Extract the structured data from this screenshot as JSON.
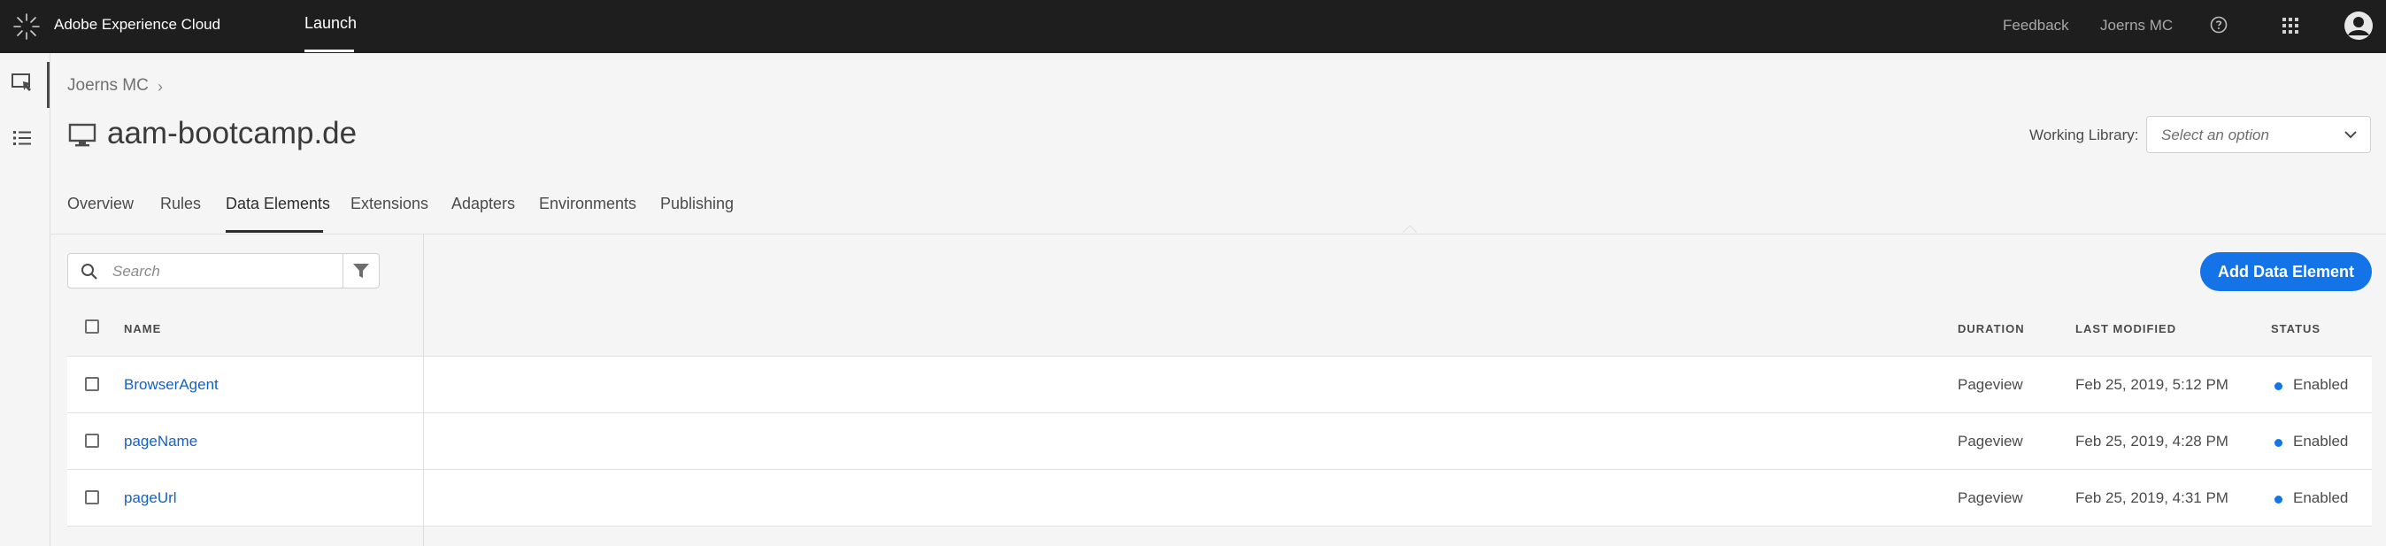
{
  "topbar": {
    "brand": "Adobe Experience Cloud",
    "app": "Launch",
    "feedback": "Feedback",
    "user": "Joerns MC",
    "icons": {
      "logo": "adobe-experience-cloud-logo",
      "help": "help-icon",
      "apps": "app-grid-icon",
      "avatar": "user-avatar-icon"
    }
  },
  "rail": {
    "icons": [
      "properties-icon",
      "list-icon"
    ]
  },
  "breadcrumb": {
    "company": "Joerns MC"
  },
  "property": {
    "name": "aam-bootcamp.de",
    "icon": "desktop-icon"
  },
  "working_library": {
    "label": "Working Library:",
    "placeholder": "Select an option"
  },
  "tabs": [
    {
      "label": "Overview"
    },
    {
      "label": "Rules"
    },
    {
      "label": "Data Elements",
      "active": true
    },
    {
      "label": "Extensions"
    },
    {
      "label": "Adapters"
    },
    {
      "label": "Environments"
    },
    {
      "label": "Publishing"
    }
  ],
  "search": {
    "placeholder": "Search"
  },
  "add_button": "Add Data Element",
  "table": {
    "headers": {
      "name": "NAME",
      "duration": "DURATION",
      "last_modified": "LAST MODIFIED",
      "status": "STATUS"
    },
    "rows": [
      {
        "name": "BrowserAgent",
        "duration": "Pageview",
        "last_modified": "Feb 25, 2019, 5:12 PM",
        "status": "Enabled"
      },
      {
        "name": "pageName",
        "duration": "Pageview",
        "last_modified": "Feb 25, 2019, 4:28 PM",
        "status": "Enabled"
      },
      {
        "name": "pageUrl",
        "duration": "Pageview",
        "last_modified": "Feb 25, 2019, 4:31 PM",
        "status": "Enabled"
      }
    ]
  },
  "colors": {
    "accent": "#1473e6",
    "topbar": "#1e1e1e",
    "link": "#1461c6",
    "status_enabled": "#1473e6"
  }
}
